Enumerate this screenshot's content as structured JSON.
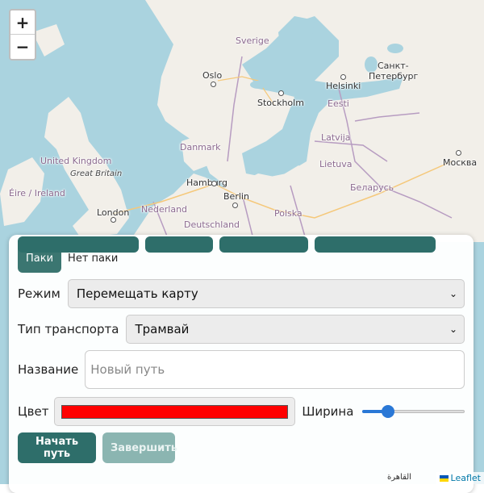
{
  "map": {
    "labels": {
      "sverige": "Sverige",
      "oslo": "Oslo",
      "stockholm": "Stockholm",
      "helsinki": "Helsinki",
      "spb_1": "Санкт-",
      "spb_2": "Петербург",
      "eesti": "Eesti",
      "latvija": "Latvija",
      "lietuva": "Lietuva",
      "moskva": "Москва",
      "belarus": "Беларусь",
      "danmark": "Danmark",
      "uk": "United Kingdom",
      "great_britain": "Great Britain",
      "eire": "Éire / Ireland",
      "london": "London",
      "hamburg": "Hamburg",
      "berlin": "Berlin",
      "nederland": "Nederland",
      "deutschland": "Deutschland",
      "polska": "Polska",
      "cairo": "القاهرة"
    },
    "zoom_in": "+",
    "zoom_out": "−",
    "attribution": "Leaflet",
    "colors": {
      "water": "#aad3df",
      "land": "#f2efe9",
      "border": "#b79cc1",
      "road": "#f5c87a"
    }
  },
  "panel": {
    "tab_active": "Паки",
    "tab_inactive": "Нет паки",
    "mode": {
      "label": "Режим",
      "value": "Перемещать карту"
    },
    "transport": {
      "label": "Тип транспорта",
      "value": "Трамвай"
    },
    "name": {
      "label": "Название",
      "placeholder": "Новый путь"
    },
    "color": {
      "label": "Цвет",
      "value": "#ff0000"
    },
    "width": {
      "label": "Ширина",
      "value_fraction": 0.25
    },
    "start_button": "Начать путь",
    "finish_button": "Завершить"
  }
}
